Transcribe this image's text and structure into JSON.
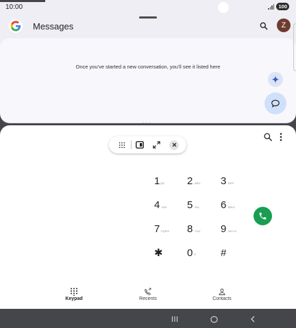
{
  "status_bar": {
    "time": "10:00",
    "battery": "100"
  },
  "messages_app": {
    "title": "Messages",
    "avatar_initial": "Z",
    "empty_state": "Once you've started a new conversation, you'll see it listed here"
  },
  "phone_app": {
    "keypad": [
      {
        "digit": "1",
        "letters": "QD"
      },
      {
        "digit": "2",
        "letters": "ABC"
      },
      {
        "digit": "3",
        "letters": "DEF"
      },
      {
        "digit": "4",
        "letters": "GHI"
      },
      {
        "digit": "5",
        "letters": "JKL"
      },
      {
        "digit": "6",
        "letters": "MNO"
      },
      {
        "digit": "7",
        "letters": "PQRS"
      },
      {
        "digit": "8",
        "letters": "TUV"
      },
      {
        "digit": "9",
        "letters": "WXYZ"
      },
      {
        "digit": "✱",
        "letters": ""
      },
      {
        "digit": "0",
        "letters": "+"
      },
      {
        "digit": "#",
        "letters": ""
      }
    ],
    "bottom_nav": {
      "keypad": "Keypad",
      "recents": "Recents",
      "contacts": "Contacts"
    }
  },
  "colors": {
    "call_green": "#1a9e52",
    "avatar_brown": "#6d3c2e",
    "fab_blue": "#cfe0fb",
    "system_nav": "#45464a"
  },
  "icons": [
    "google-logo-icon",
    "search-icon",
    "gemini-sparkle-icon",
    "start-chat-icon",
    "dialpad-icon",
    "split-screen-icon",
    "fullscreen-icon",
    "close-icon",
    "more-vert-icon",
    "phone-icon",
    "recents-icon",
    "contacts-icon",
    "recent-apps-icon",
    "home-icon",
    "back-icon"
  ]
}
